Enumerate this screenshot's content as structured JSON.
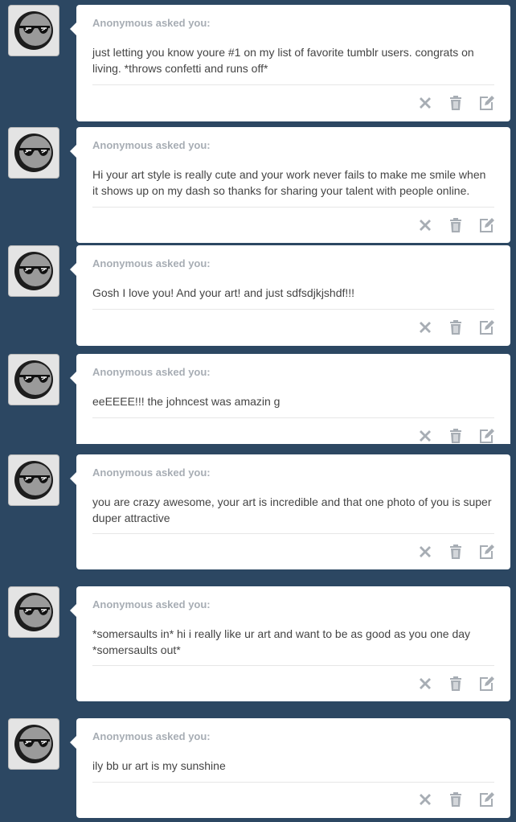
{
  "colors": {
    "background": "#2c4762",
    "card": "#ffffff",
    "asker_text": "#a7adb4",
    "body_text": "#444444",
    "action_icon": "#a7adb4"
  },
  "asks": [
    {
      "asker": "Anonymous asked you:",
      "question": "just letting you know youre #1 on my list of favorite tumblr users. congrats on living. *throws confetti and runs off*",
      "actions": [
        "delete-x-icon",
        "trash-icon",
        "edit-icon"
      ]
    },
    {
      "asker": "Anonymous asked you:",
      "question": "Hi your art style is really cute and your work never fails to make me smile when it shows up on my dash so thanks for sharing your talent with people online.",
      "actions": [
        "delete-x-icon",
        "trash-icon",
        "edit-icon"
      ]
    },
    {
      "asker": "Anonymous asked you:",
      "question": "Gosh I love you! And your art! and just sdfsdjkjshdf!!!",
      "actions": [
        "delete-x-icon",
        "trash-icon",
        "edit-icon"
      ]
    },
    {
      "asker": "Anonymous asked you:",
      "question": "eeEEEE!!! the johncest was amazin g",
      "actions": [
        "delete-x-icon",
        "trash-icon",
        "edit-icon"
      ]
    },
    {
      "asker": "Anonymous asked you:",
      "question": "you are crazy awesome, your art is incredible and that one photo of you is super duper attractive",
      "actions": [
        "delete-x-icon",
        "trash-icon",
        "edit-icon"
      ]
    },
    {
      "asker": "Anonymous asked you:",
      "question": "*somersaults in* hi i really like ur art and want to be as good as you one day *somersaults out*",
      "actions": [
        "delete-x-icon",
        "trash-icon",
        "edit-icon"
      ]
    },
    {
      "asker": "Anonymous asked you:",
      "question": "ily bb ur art is my sunshine",
      "actions": [
        "delete-x-icon",
        "trash-icon",
        "edit-icon"
      ]
    }
  ]
}
